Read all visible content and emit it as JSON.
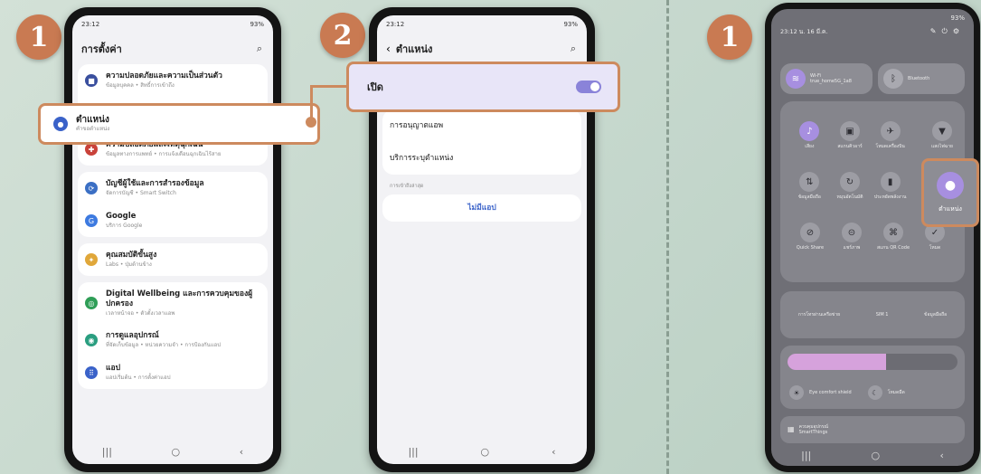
{
  "badges": [
    "1",
    "2",
    "1"
  ],
  "phone1": {
    "time": "23:12",
    "status_right": "93%",
    "title": "การตั้งค่า",
    "items": [
      {
        "title": "ความปลอดภัยและความเป็นส่วนตัว",
        "subtitle": "ข้อมูลบุคคล • สิทธิ์การเข้าถึง",
        "color": "#3a4f9e"
      },
      {
        "title": "ตำแหน่ง",
        "subtitle": "คำขอตำแหน่ง",
        "color": "#3a62c9"
      },
      {
        "title": "ความปลอดภัยและเหตุฉุกเฉิน",
        "subtitle": "ข้อมูลทางการแพทย์ • การแจ้งเตือนฉุกเฉินไร้สาย",
        "color": "#c9423a"
      },
      {
        "title": "บัญชีผู้ใช้และการสำรองข้อมูล",
        "subtitle": "จัดการบัญชี • Smart Switch",
        "color": "#3b6fc4"
      },
      {
        "title": "Google",
        "subtitle": "บริการ Google",
        "color": "#3d7ae0"
      },
      {
        "title": "คุณสมบัติขั้นสูง",
        "subtitle": "Labs • ปุ่มด้านข้าง",
        "color": "#e0a73a"
      },
      {
        "title": "Digital Wellbeing และการควบคุมของผู้ปกครอง",
        "subtitle": "เวลาหน้าจอ • ตัวตั้งเวลาแอพ",
        "color": "#2f9e57"
      },
      {
        "title": "การดูแลอุปกรณ์",
        "subtitle": "ที่จัดเก็บข้อมูล • หน่วยความจำ • การป้องกันแอป",
        "color": "#2a9e80"
      },
      {
        "title": "แอป",
        "subtitle": "แอปเริ่มต้น • การตั้งค่าแอป",
        "color": "#3a62c9"
      }
    ]
  },
  "phone2": {
    "time": "23:12",
    "status_right": "93%",
    "title": "ตำแหน่ง",
    "toggle_label": "เปิด",
    "toggle_on": true,
    "items": [
      "การอนุญาตแอพ",
      "บริการระบุตำแหน่ง"
    ],
    "section_label": "การเข้าถึงล่าสุด",
    "empty_text": "ไม่มีแอป"
  },
  "phone3": {
    "datetime": "23:12 น. 16 มี.ค.",
    "status_right": "93%",
    "wifi_label": "Wi-Fi",
    "wifi_sub": "true_home5G_1a8",
    "bt_label": "Bluetooth",
    "tiles_row1": [
      "เสียง",
      "สแกนคิวอาร์",
      "โหมดเครื่องบิน",
      "แสงไฟฉาย"
    ],
    "tiles_row2": [
      "ข้อมูลมือถือ",
      "หมุนอัตโนมัติ",
      "ประหยัดพลังงาน"
    ],
    "location_label": "ตำแหน่ง",
    "tiles_row3": [
      "Quick Share",
      "แชร์ภาพ",
      "สแกน QR Code",
      "โหมด"
    ],
    "media_1": "การโทรผ่านเครือข่าย",
    "media_2": "SIM 1",
    "media_3": "ข้อมูลมือถือ",
    "eye_label": "Eye comfort shield",
    "dark_label": "โหมดมืด",
    "bottom_label": "ควบคุมอุปกรณ์",
    "bottom_sub": "SmartThings",
    "accent": "#a78fe0"
  }
}
